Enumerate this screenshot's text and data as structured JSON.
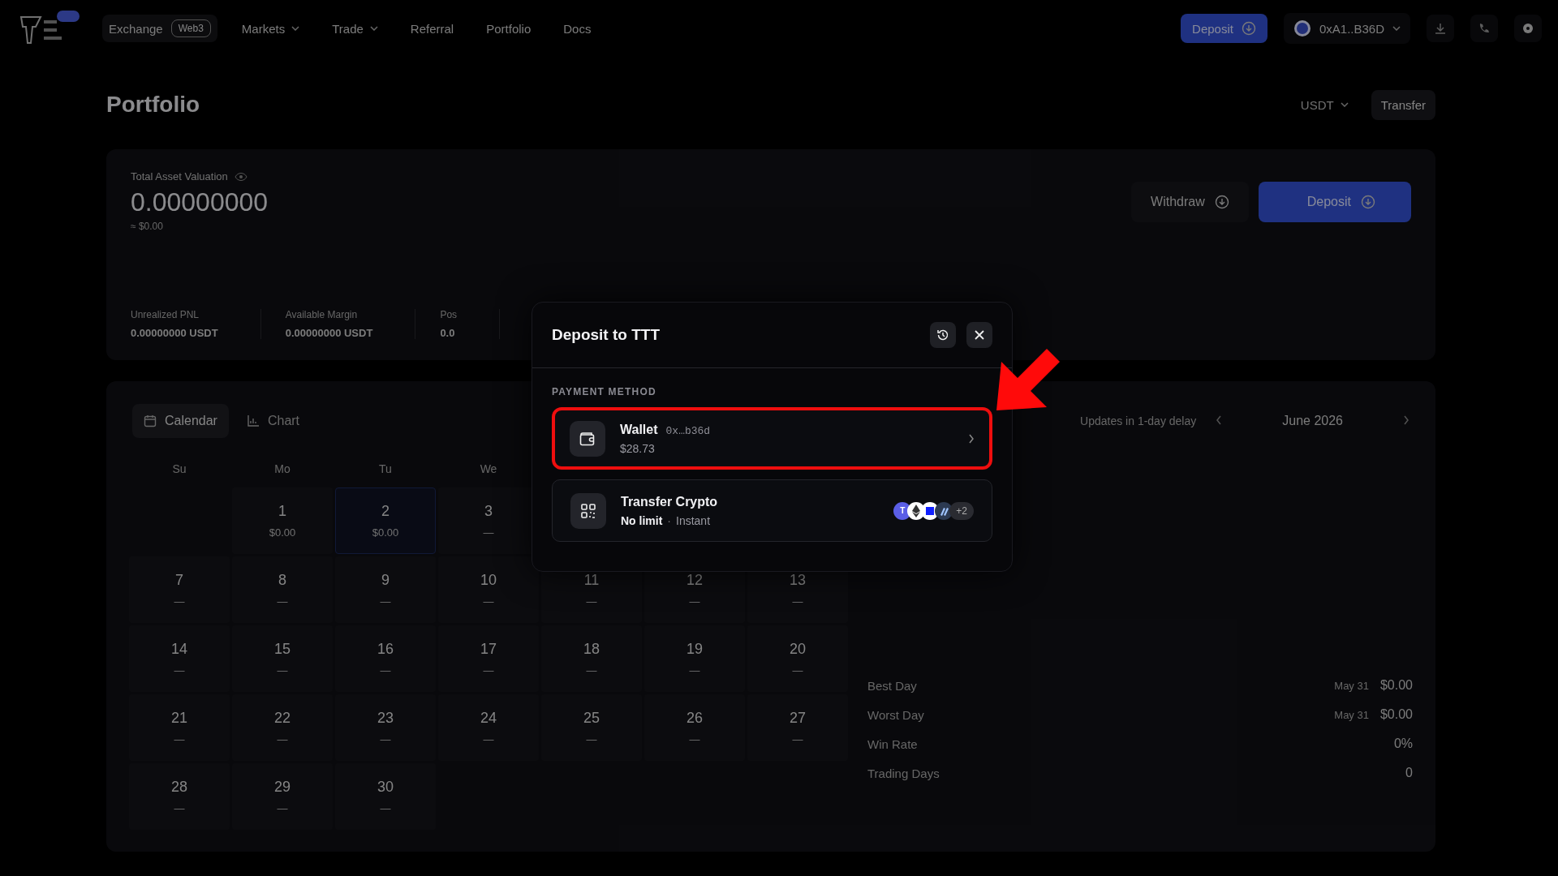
{
  "nav": {
    "exchange": {
      "label": "Exchange",
      "tag": "Web3",
      "selected": true
    },
    "items": [
      {
        "label": "Markets",
        "dropdown": true
      },
      {
        "label": "Trade",
        "dropdown": true
      },
      {
        "label": "Referral",
        "dropdown": false
      },
      {
        "label": "Portfolio",
        "dropdown": false
      },
      {
        "label": "Docs",
        "dropdown": false
      }
    ],
    "deposit_button": "Deposit",
    "wallet": "0xA1..B36D"
  },
  "page": {
    "title": "Portfolio",
    "currency": "USDT",
    "transfer_button": "Transfer"
  },
  "summary": {
    "label": "Total Asset Valuation",
    "value": "0.00000000",
    "approx": "≈ $0.00",
    "withdraw_button": "Withdraw",
    "deposit_button": "Deposit",
    "metrics": [
      {
        "label": "Unrealized PNL",
        "value": "0.00000000 USDT"
      },
      {
        "label": "Available Margin",
        "value": "0.00000000 USDT"
      },
      {
        "label": "Pos",
        "value": "0.0"
      }
    ]
  },
  "calendar": {
    "tabs": [
      {
        "label": "Calendar",
        "selected": true
      },
      {
        "label": "Chart",
        "selected": false
      }
    ],
    "note": "Updates in 1-day delay",
    "month": "June 2026",
    "weekdays": [
      "Su",
      "Mo",
      "Tu",
      "We"
    ],
    "weeks": [
      [
        {
          "day": "1",
          "value": "$0.00",
          "selected": false
        },
        {
          "day": "2",
          "value": "$0.00",
          "selected": true
        },
        {
          "day": "3",
          "value": "—",
          "selected": false
        }
      ],
      [
        {
          "day": "7",
          "value": "—",
          "selected": false
        },
        {
          "day": "8",
          "value": "—",
          "selected": false
        },
        {
          "day": "9",
          "value": "—",
          "selected": false
        },
        {
          "day": "10",
          "value": "—",
          "selected": false
        },
        {
          "day": "11",
          "value": "—",
          "selected": false
        },
        {
          "day": "12",
          "value": "—",
          "selected": false
        },
        {
          "day": "13",
          "value": "—",
          "selected": false
        }
      ],
      [
        {
          "day": "14",
          "value": "—",
          "selected": false
        },
        {
          "day": "15",
          "value": "—",
          "selected": false
        },
        {
          "day": "16",
          "value": "—",
          "selected": false
        },
        {
          "day": "17",
          "value": "—",
          "selected": false
        },
        {
          "day": "18",
          "value": "—",
          "selected": false
        },
        {
          "day": "19",
          "value": "—",
          "selected": false
        },
        {
          "day": "20",
          "value": "—",
          "selected": false
        }
      ],
      [
        {
          "day": "21",
          "value": "—",
          "selected": false
        },
        {
          "day": "22",
          "value": "—",
          "selected": false
        },
        {
          "day": "23",
          "value": "—",
          "selected": false
        },
        {
          "day": "24",
          "value": "—",
          "selected": false
        },
        {
          "day": "25",
          "value": "—",
          "selected": false
        },
        {
          "day": "26",
          "value": "—",
          "selected": false
        },
        {
          "day": "27",
          "value": "—",
          "selected": false
        }
      ],
      [
        {
          "day": "28",
          "value": "—",
          "selected": false
        },
        {
          "day": "29",
          "value": "—",
          "selected": false
        },
        {
          "day": "30",
          "value": "—",
          "selected": false
        }
      ]
    ],
    "stats": [
      {
        "label": "Best Day",
        "date": "May 31",
        "value": "$0.00"
      },
      {
        "label": "Worst Day",
        "date": "May 31",
        "value": "$0.00"
      },
      {
        "label": "Win Rate",
        "value": "0%"
      },
      {
        "label": "Trading Days",
        "value": "0"
      }
    ]
  },
  "modal": {
    "title": "Deposit to TTT",
    "section_label": "PAYMENT METHOD",
    "methods": [
      {
        "kind": "wallet",
        "name": "Wallet",
        "address": "0x…b36d",
        "detail": "$28.73",
        "highlighted": true
      },
      {
        "kind": "transfer",
        "name": "Transfer Crypto",
        "limit": "No limit",
        "separator": "·",
        "speed": "Instant",
        "highlighted": false,
        "tokens": [
          {
            "kind": "letter",
            "label": "T",
            "color": "#5a5ee6"
          },
          {
            "kind": "diamond",
            "color": "#ffffff"
          },
          {
            "kind": "square",
            "color": "#ffffff"
          },
          {
            "kind": "stripes",
            "color": "#2c3a52"
          }
        ],
        "more": "+2"
      }
    ]
  }
}
